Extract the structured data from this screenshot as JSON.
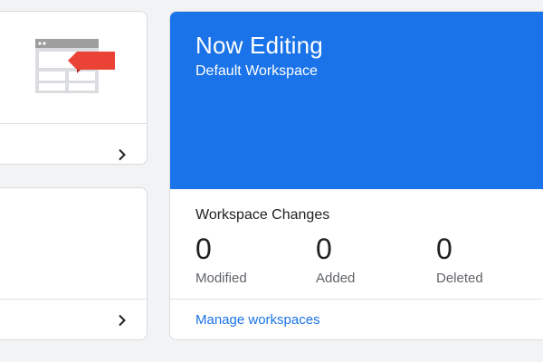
{
  "workspace_card": {
    "heading": "Now Editing",
    "workspace_name": "Default Workspace",
    "changes_title": "Workspace Changes",
    "stats": [
      {
        "value": "0",
        "label": "Modified"
      },
      {
        "value": "0",
        "label": "Added"
      },
      {
        "value": "0",
        "label": "Deleted"
      }
    ],
    "manage_link": "Manage workspaces",
    "accent_color": "#1a73e8"
  },
  "left_cards": {
    "top_icon": "container-tag-illustration",
    "chevron_icon": "chevron-right-icon"
  }
}
